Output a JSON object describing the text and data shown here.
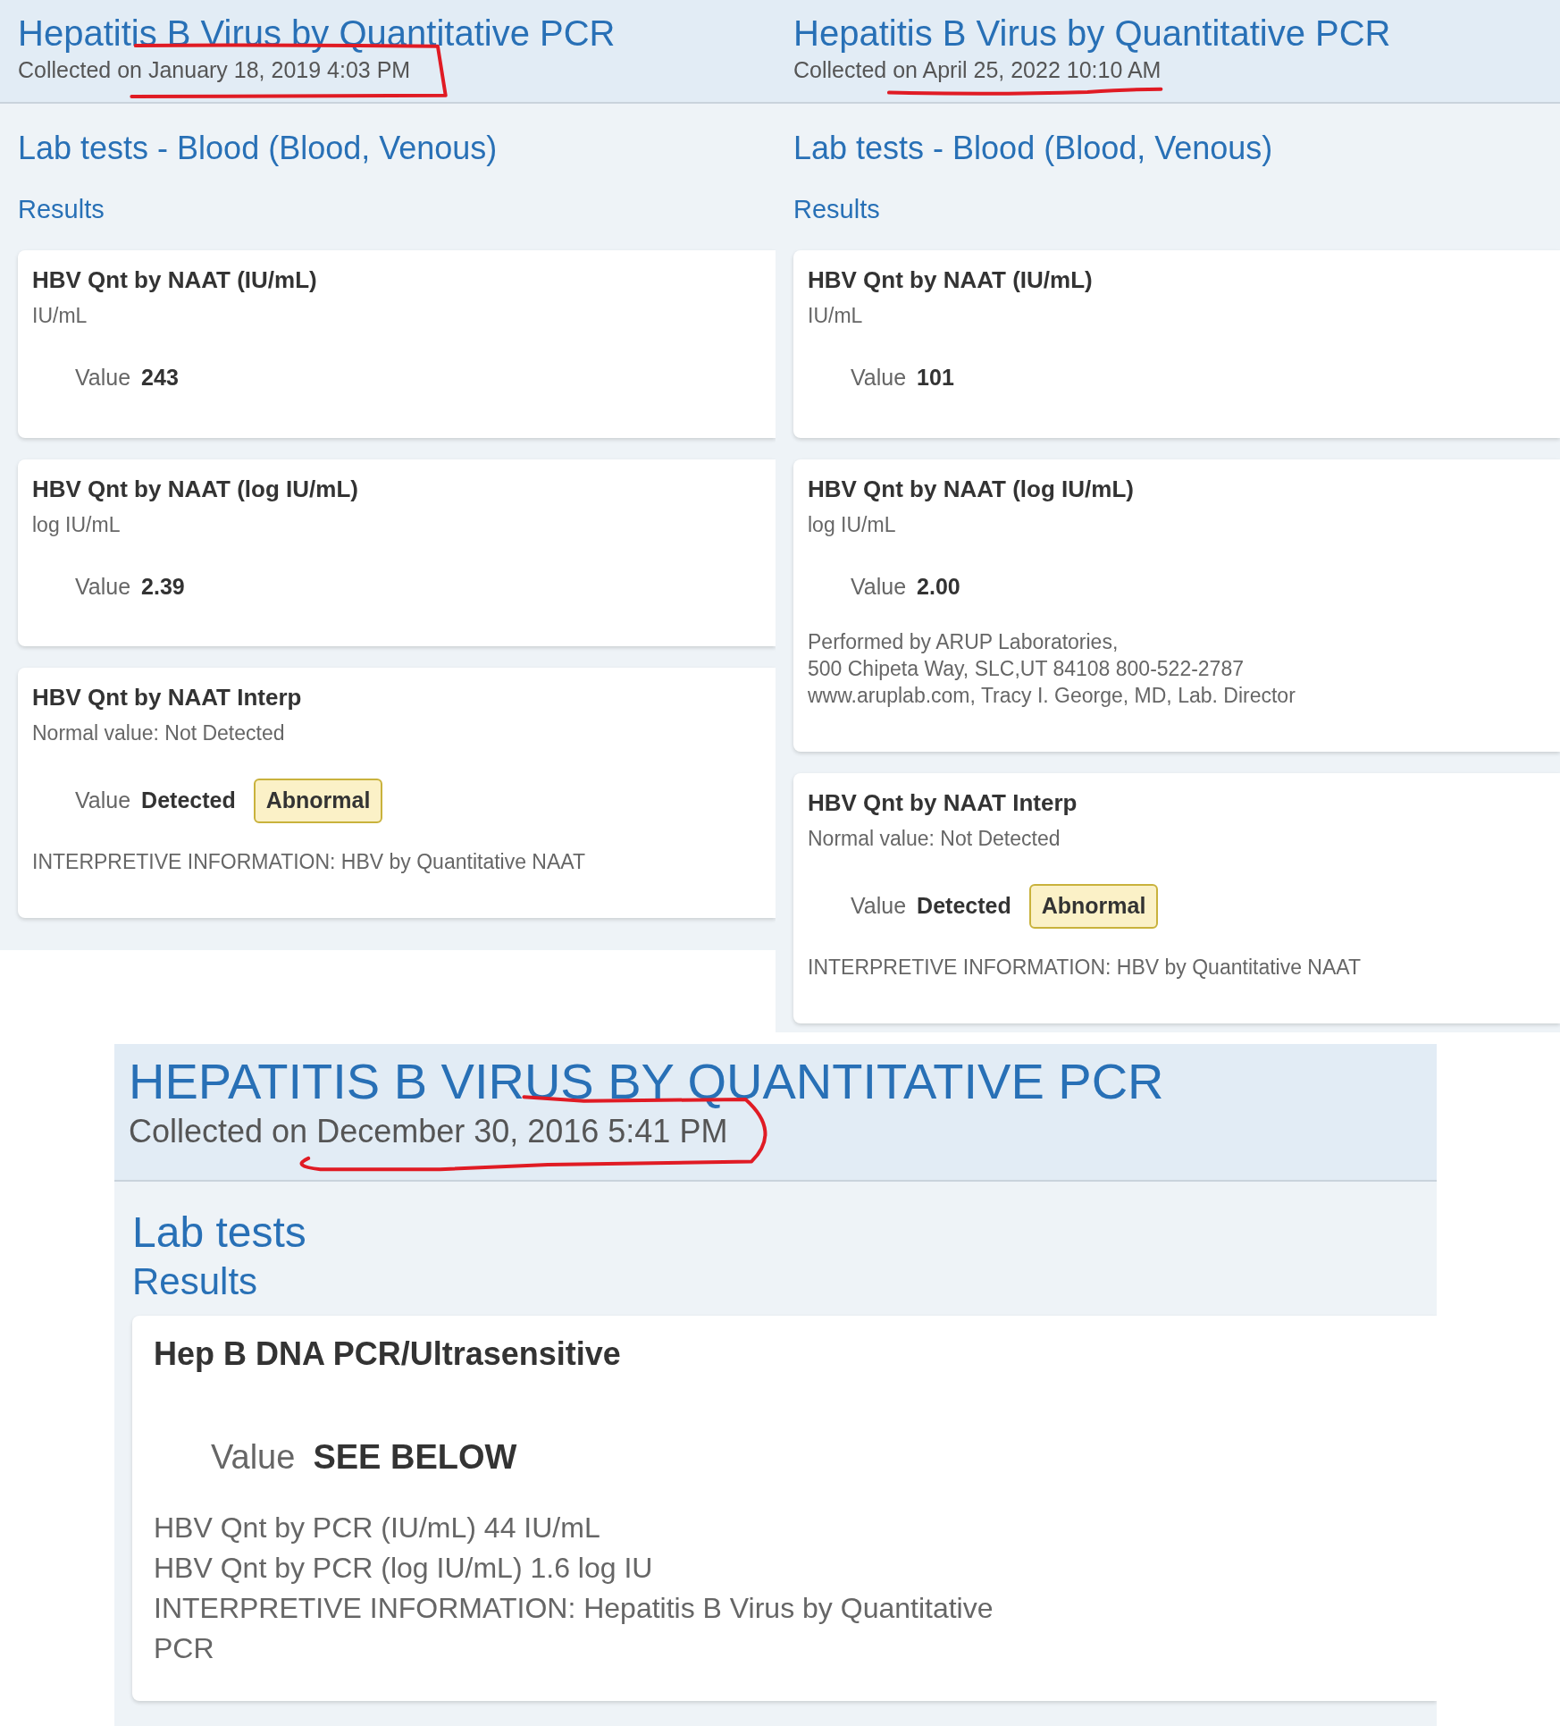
{
  "panels": [
    {
      "title": "Hepatitis B Virus by Quantitative PCR",
      "collected": "Collected on January 18, 2019 4:03 PM",
      "annotation": {
        "kind": "box"
      },
      "section": "Lab tests - Blood (Blood, Venous)",
      "subsection": "Results",
      "results": [
        {
          "name": "HBV Qnt by NAAT (IU/mL)",
          "unit": "IU/mL",
          "value_label": "Value",
          "value": "243"
        },
        {
          "name": "HBV Qnt by NAAT (log IU/mL)",
          "unit": "log IU/mL",
          "value_label": "Value",
          "value": "2.39"
        },
        {
          "name": "HBV Qnt by NAAT Interp",
          "unit": "Normal value: Not Detected",
          "value_label": "Value",
          "value": "Detected",
          "flag": "Abnormal",
          "notes": [
            "INTERPRETIVE INFORMATION: HBV by Quantitative NAAT"
          ]
        }
      ]
    },
    {
      "title": "Hepatitis B Virus by Quantitative PCR",
      "collected": "Collected on April 25, 2022 10:10 AM",
      "annotation": {
        "kind": "underline"
      },
      "section": "Lab tests - Blood (Blood, Venous)",
      "subsection": "Results",
      "results": [
        {
          "name": "HBV Qnt by NAAT (IU/mL)",
          "unit": "IU/mL",
          "value_label": "Value",
          "value": "101"
        },
        {
          "name": "HBV Qnt by NAAT (log IU/mL)",
          "unit": "log IU/mL",
          "value_label": "Value",
          "value": "2.00",
          "notes": [
            "Performed by ARUP Laboratories,",
            "500 Chipeta Way, SLC,UT 84108 800-522-2787",
            "www.aruplab.com, Tracy I. George, MD, Lab. Director"
          ]
        },
        {
          "name": "HBV Qnt by NAAT Interp",
          "unit": "Normal value: Not Detected",
          "value_label": "Value",
          "value": "Detected",
          "flag": "Abnormal",
          "notes": [
            "INTERPRETIVE INFORMATION: HBV by Quantitative NAAT"
          ]
        }
      ]
    },
    {
      "title": "HEPATITIS B VIRUS BY QUANTITATIVE PCR",
      "collected": "Collected on December 30, 2016 5:41 PM",
      "annotation": {
        "kind": "loop"
      },
      "section": "Lab tests",
      "subsection": "Results",
      "results": [
        {
          "name": "Hep B DNA PCR/Ultrasensitive",
          "value_label": "Value",
          "value": "SEE BELOW",
          "notes": [
            "HBV Qnt by PCR (IU/mL) 44 IU/mL",
            "HBV Qnt by PCR (log IU/mL) 1.6 log IU",
            "INTERPRETIVE INFORMATION: Hepatitis B Virus by Quantitative",
            "PCR"
          ]
        }
      ]
    }
  ]
}
